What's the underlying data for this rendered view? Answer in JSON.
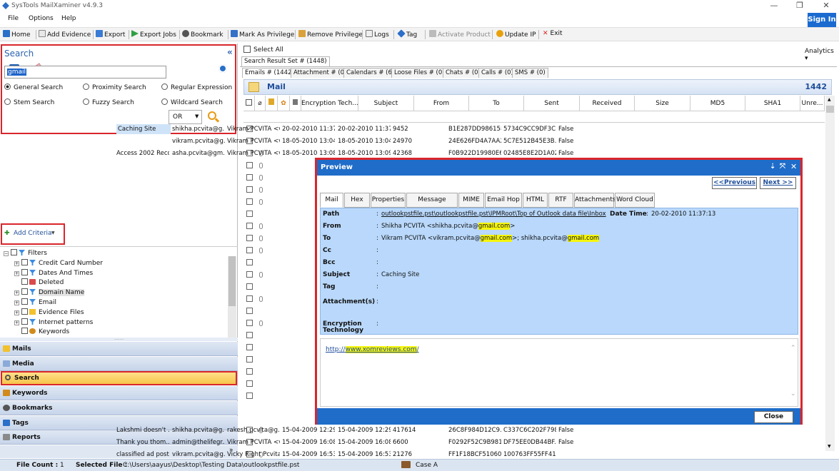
{
  "app": {
    "title": "SysTools MailXaminer v4.9.3",
    "sign_in": "Sign In"
  },
  "menu": [
    "File",
    "Options",
    "Help"
  ],
  "toolbar": [
    "Home",
    "Add Evidence",
    "Export",
    "Export Jobs",
    "Bookmark",
    "Mark As Privilege",
    "Remove Privilege",
    "Logs",
    "Tag",
    "Activate Product",
    "Update IP",
    "Exit"
  ],
  "analytics": "Analytics",
  "search": {
    "title": "Search",
    "collapse": "«",
    "modes": [
      "General Search",
      "Proximity Search",
      "Regular Expression",
      "Stem Search",
      "Fuzzy Search",
      "Wildcard Search"
    ],
    "selected_mode": "General Search",
    "query": "gmail",
    "operator": "OR"
  },
  "add_criteria": "Add Criteria",
  "filters": {
    "root": "Filters",
    "items": [
      "Credit Card Number",
      "Dates And Times",
      "Deleted",
      "Domain Name",
      "Email",
      "Evidence Files",
      "Internet patterns",
      "Keywords"
    ]
  },
  "nav": [
    "Mails",
    "Media",
    "Search",
    "Keywords",
    "Bookmarks",
    "Tags",
    "Reports"
  ],
  "nav_active": "Search",
  "status": {
    "file_count_label": "File Count :",
    "file_count": "1",
    "selected_file_label": "Selected File :",
    "selected_file": "C:\\Users\\aayus\\Desktop\\Testing Data\\outlookpstfile.pst",
    "case": "Case A"
  },
  "results": {
    "select_all": "Select All",
    "result_tab": "Search Result Set # (1448)",
    "tabs": [
      "Emails # (1442)",
      "Attachment # (0)",
      "Calendars # (6)",
      "Loose Files # (0)",
      "Chats # (0)",
      "Calls # (0)",
      "SMS # (0)"
    ],
    "header_title": "Mail",
    "header_count": "1442",
    "columns": [
      "Encryption Tech...",
      "Subject",
      "From",
      "To",
      "Sent",
      "Received",
      "Size",
      "MD5",
      "SHA1",
      "Unre..."
    ],
    "rows": [
      {
        "subject": "Caching Site",
        "from": "shikha.pcvita@g...",
        "to": "Vikram PCVITA <v...",
        "sent": "20-02-2010 11:37:...",
        "received": "20-02-2010 11:37:...",
        "size": "9452",
        "md5": "B1E287DD986158...",
        "sha1": "5734C9CC9DF3C...",
        "unread": "False"
      },
      {
        "subject": "",
        "from": "vikram.pcvita@g...",
        "to": "Vikram PCVITA <v...",
        "sent": "18-05-2010 13:04:...",
        "received": "18-05-2010 13:04:...",
        "size": "24970",
        "md5": "24E626FD4A7AA2...",
        "sha1": "5C7E512B45E3B...",
        "unread": "False"
      },
      {
        "subject": "Access 2002 Reco...",
        "from": "asha.pcvita@gm...",
        "to": "Vikram PCVITA <v...",
        "sent": "18-05-2010 13:08:...",
        "received": "18-05-2010 13:09:...",
        "size": "42368",
        "md5": "F0B922D19980E6...",
        "sha1": "02485E8E2D1A02...",
        "unread": "False"
      }
    ],
    "unread_col": [
      "False",
      "False",
      "False",
      "False",
      "False",
      "False",
      "False",
      "False",
      "False",
      "False",
      "False",
      "False",
      "False",
      "False",
      "False",
      "False",
      "False",
      "False",
      "False",
      "False"
    ],
    "bottom_rows": [
      {
        "subject": "Lakshmi doesn't ...",
        "from": "shikha.pcvita@g...",
        "to": "rakesh.pcvita@g...",
        "sent": "15-04-2009 12:29:...",
        "received": "15-04-2009 12:29:...",
        "size": "417614",
        "md5": "26C8F984D12C9...",
        "sha1": "C337C6C202F798...",
        "unread": "False"
      },
      {
        "subject": "Thank you thom...",
        "from": "admin@thelifegr...",
        "to": "Vikram PCVITA <v...",
        "sent": "15-04-2009 16:08:...",
        "received": "15-04-2009 16:08:...",
        "size": "6600",
        "md5": "F0292F52C9B981...",
        "sha1": "DF75EE0DB44BF...",
        "unread": "False"
      },
      {
        "subject": "classified ad post...",
        "from": "vikram.pcvita@g...",
        "to": "Vicky Right Pcvita...",
        "sent": "15-04-2009 16:53:...",
        "received": "15-04-2009 16:53:...",
        "size": "21276",
        "md5": "FF1F18BCF51060...",
        "sha1": "100763FF55FF411...",
        "unread": ""
      }
    ]
  },
  "preview": {
    "title": "Preview",
    "prev": "<<Previous",
    "next": "Next >>",
    "tabs": [
      "Mail",
      "Hex",
      "Properties",
      "Message Header",
      "MIME",
      "Email Hop",
      "HTML",
      "RTF",
      "Attachments",
      "Word Cloud"
    ],
    "path_label": "Path",
    "path": "outlookpstfile.pst\\outlookpstfile.pst\\IPMRoot\\Top of Outlook data file\\Inbox",
    "date_label": "Date Time",
    "date": "20-02-2010 11:37:13",
    "from_label": "From",
    "from_pre": "Shikha PCVITA <shikha.pcvita@",
    "to_label": "To",
    "to_pre": "Vikram PCVITA <vikram.pcvita@",
    "to_mid": ">; shikha.pcvita@",
    "hl": "gmail.com",
    "cc_label": "Cc",
    "bcc_label": "Bcc",
    "subject_label": "Subject",
    "subject": "Caching Site",
    "tag_label": "Tag",
    "attach_label": "Attachment(s)",
    "enc_label1": "Encryption",
    "enc_label2": "Technology",
    "colon": ":",
    "body_link_pre": "http://",
    "body_link_hl": "www.xomreviews.com",
    "body_link_post": "/",
    "close": "Close"
  }
}
